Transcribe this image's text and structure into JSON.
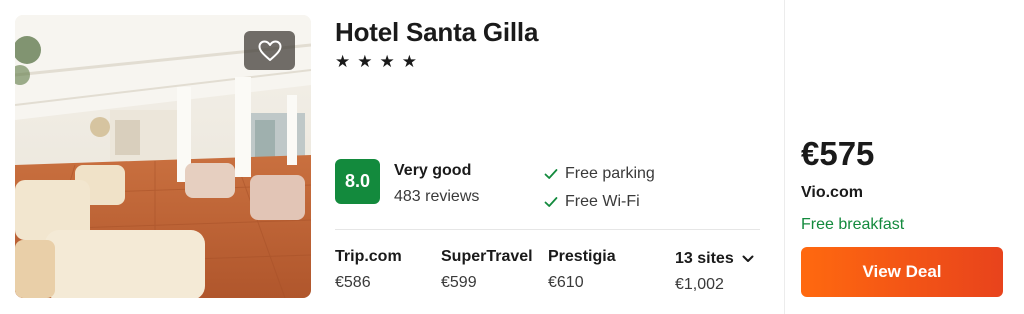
{
  "hotel": {
    "name": "Hotel Santa Gilla",
    "stars": 4,
    "star_glyph": "★"
  },
  "rating": {
    "score": "8.0",
    "label": "Very good",
    "reviews": "483 reviews",
    "score_color": "#138a3d"
  },
  "amenities": [
    {
      "label": "Free parking",
      "icon": "check-icon"
    },
    {
      "label": "Free Wi-Fi",
      "icon": "check-icon"
    }
  ],
  "sites": [
    {
      "name": "Trip.com",
      "price": "€586"
    },
    {
      "name": "SuperTravel",
      "price": "€599"
    },
    {
      "name": "Prestigia",
      "price": "€610"
    }
  ],
  "more_sites": {
    "label": "13 sites",
    "price": "€1,002",
    "icon": "chevron-down-icon"
  },
  "deal": {
    "price": "€575",
    "provider": "Vio.com",
    "perk": "Free breakfast",
    "button_label": "View Deal",
    "accent": "#ff690f"
  },
  "favorite": {
    "icon": "heart-icon"
  }
}
